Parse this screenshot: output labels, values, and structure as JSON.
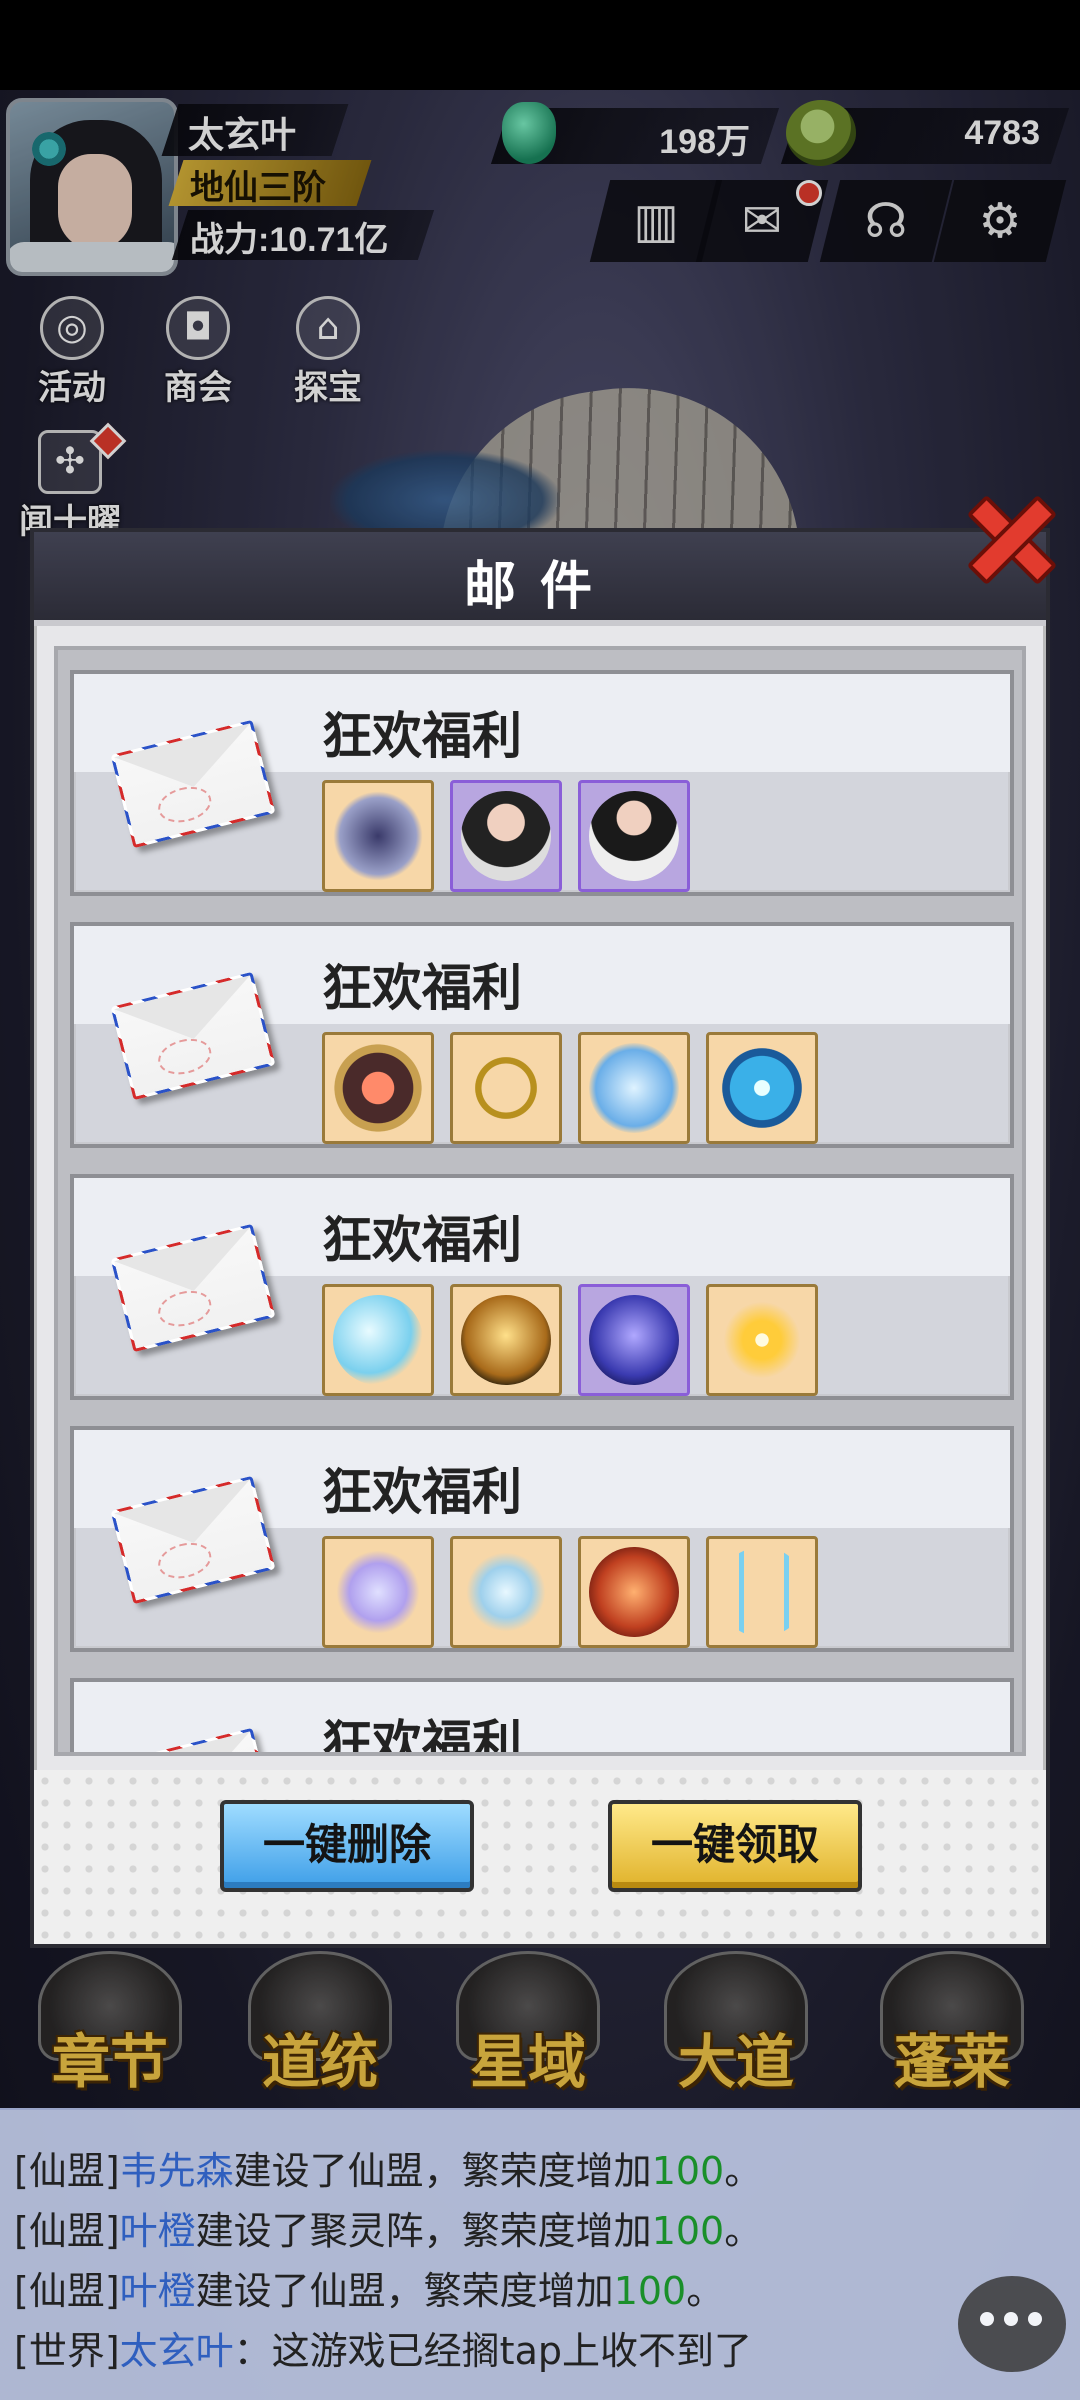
{
  "player": {
    "name": "太玄叶",
    "rank": "地仙三阶",
    "power": "战力:10.71亿"
  },
  "currency": {
    "jade": "198万",
    "coins": "4783"
  },
  "side_menu": {
    "activity": "活动",
    "shop": "商会",
    "treasure": "探宝",
    "news": "闻十曜"
  },
  "mail_dialog": {
    "title": "邮件",
    "items": [
      {
        "title": "狂欢福利",
        "rewards": [
          "fashion-bag-icon",
          "female-portrait-icon",
          "female-portrait-icon"
        ]
      },
      {
        "title": "狂欢福利",
        "rewards": [
          "gold-orb-icon",
          "gold-necklace-icon",
          "ice-warrior-icon",
          "blue-vortex-icon"
        ]
      },
      {
        "title": "狂欢福利",
        "rewards": [
          "ice-dragon-icon",
          "golden-warrior-icon",
          "purple-spirit-icon",
          "golden-sunburst-icon"
        ]
      },
      {
        "title": "狂欢福利",
        "rewards": [
          "butterfly-icon",
          "feather-icon",
          "fire-lion-icon",
          "triple-sword-icon"
        ]
      },
      {
        "title": "狂欢福利",
        "rewards": []
      }
    ],
    "delete_all": "一键删除",
    "claim_all": "一键领取"
  },
  "bottom_nav": [
    "章节",
    "道统",
    "星域",
    "大道",
    "蓬莱"
  ],
  "chat": [
    {
      "channel": "[仙盟]",
      "who": "韦先森",
      "text": "建设了仙盟，繁荣度增加",
      "num": "100",
      "end": "。"
    },
    {
      "channel": "[仙盟]",
      "who": "叶橙",
      "text": "建设了聚灵阵，繁荣度增加",
      "num": "100",
      "end": "。"
    },
    {
      "channel": "[仙盟]",
      "who": "叶橙",
      "text": "建设了仙盟，繁荣度增加",
      "num": "100",
      "end": "。"
    },
    {
      "channel": "[世界]",
      "who": "太玄叶",
      "text": "：这游戏已经搁tap上收不到了",
      "num": "",
      "end": ""
    }
  ]
}
